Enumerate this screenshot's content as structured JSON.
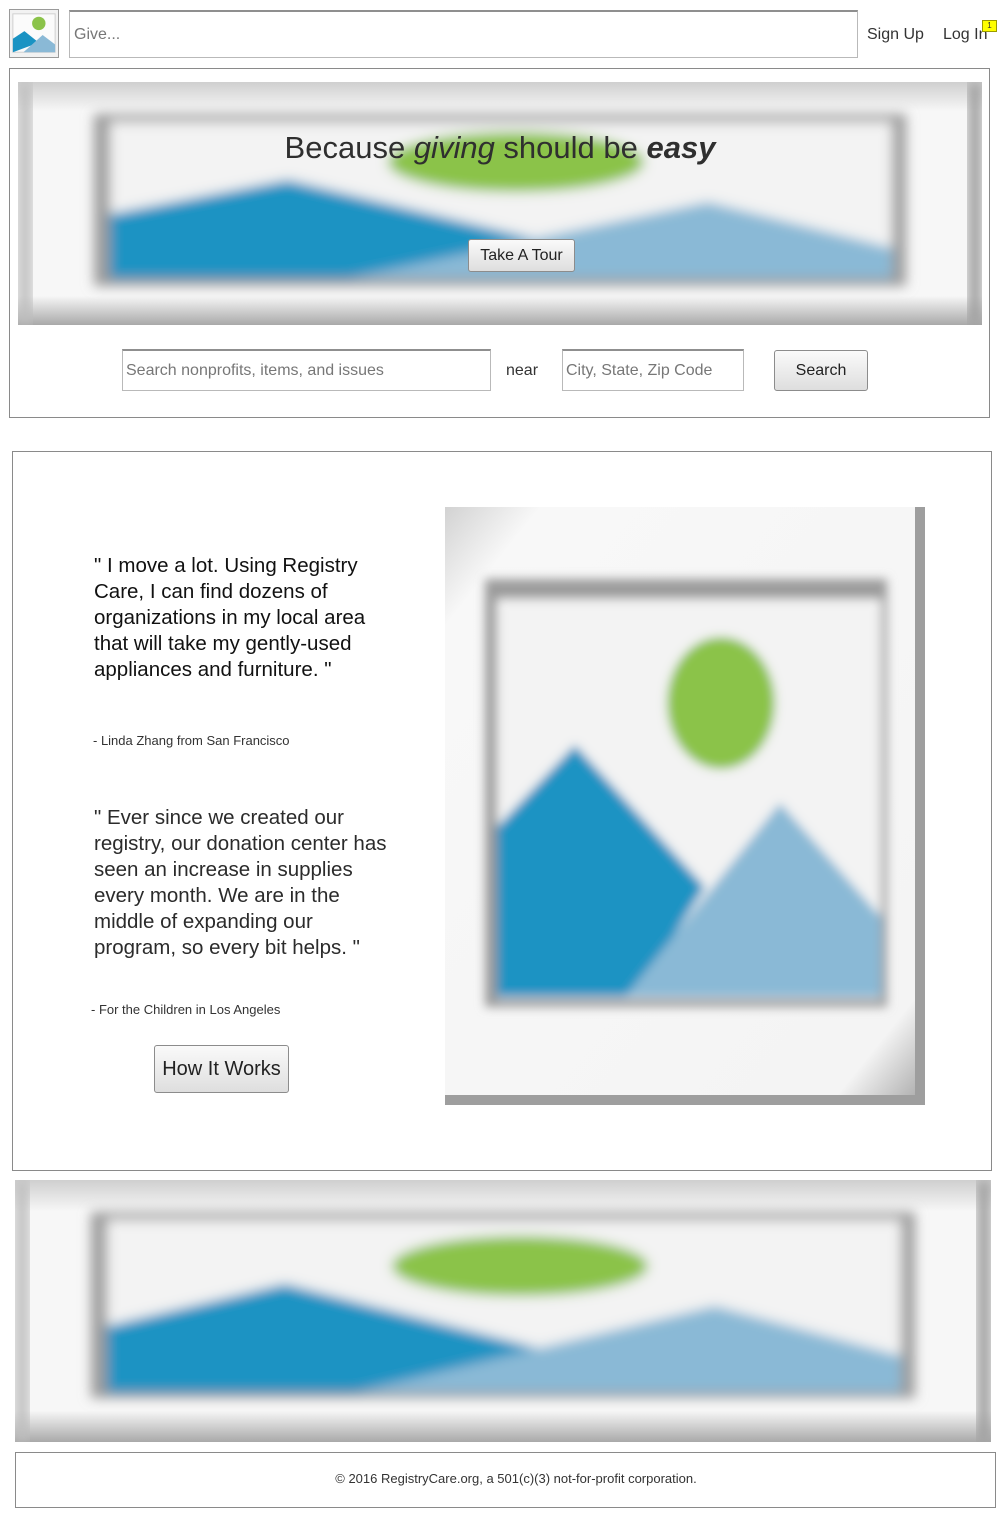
{
  "header": {
    "logo_icon": "image-placeholder-icon",
    "give_placeholder": "Give...",
    "signup_label": "Sign Up",
    "login_label": "Log In",
    "notification_count": "1"
  },
  "hero": {
    "title_part1": "Because ",
    "title_em1": "giving",
    "title_part2": " should be ",
    "title_em2": "easy",
    "tour_button": "Take A Tour",
    "search_placeholder": "Search nonprofits, items, and issues",
    "near_label": "near",
    "location_placeholder": "City, State, Zip Code",
    "search_button": "Search"
  },
  "testimonials": [
    {
      "quote": "\" I move a lot. Using Registry Care, I can find dozens of organizations in my local area that will take my gently-used appliances and furniture. \"",
      "author": "- Linda Zhang from San Francisco"
    },
    {
      "quote": "\" Ever since we created our registry, our donation center has seen an increase in supplies every month. We are in the middle of expanding our program, so every bit helps. \"",
      "author": "- For the Children in Los Angeles"
    }
  ],
  "how_it_works_button": "How It Works",
  "footer": {
    "text": "© 2016 RegistryCare.org, a 501(c)(3) not-for-profit corporation."
  },
  "colors": {
    "sun": "#8bc34a",
    "mountain_dark": "#1a93c3",
    "mountain_light": "#8ab9d6",
    "badge": "#ffff00"
  }
}
